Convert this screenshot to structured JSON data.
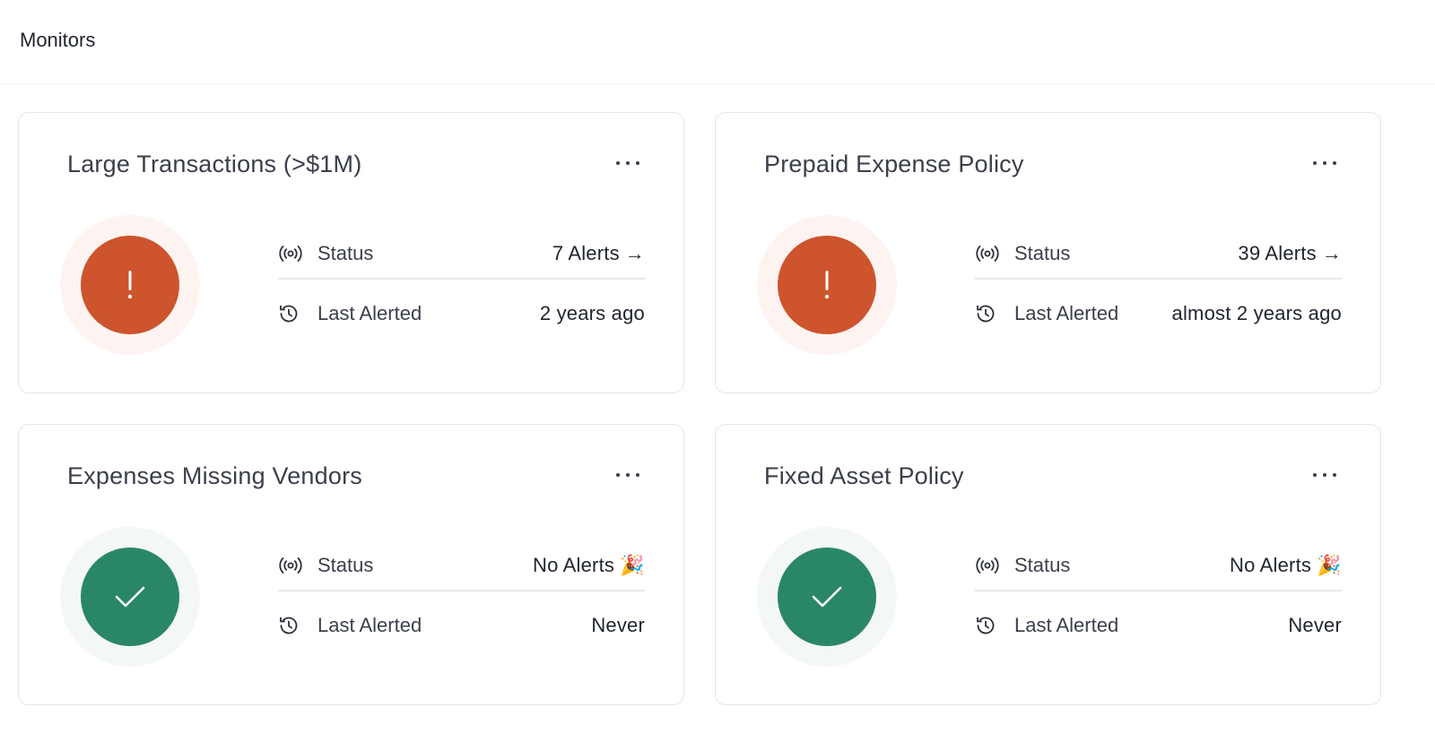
{
  "header": {
    "title": "Monitors"
  },
  "labels": {
    "status": "Status",
    "last_alerted": "Last Alerted"
  },
  "colors": {
    "alert": "#cd542c",
    "ok": "#2a8766"
  },
  "monitors": [
    {
      "title": "Large Transactions (>$1M)",
      "state": "alert",
      "status_value": "7 Alerts",
      "status_arrow": "→",
      "last_alerted": "2 years ago",
      "status_icon": "exclamation-icon"
    },
    {
      "title": "Prepaid Expense Policy",
      "state": "alert",
      "status_value": "39 Alerts",
      "status_arrow": "→",
      "last_alerted": "almost 2 years ago",
      "status_icon": "exclamation-icon"
    },
    {
      "title": "Expenses Missing Vendors",
      "state": "ok",
      "status_value": "No Alerts 🎉",
      "status_arrow": "",
      "last_alerted": "Never",
      "status_icon": "check-icon"
    },
    {
      "title": "Fixed Asset Policy",
      "state": "ok",
      "status_value": "No Alerts 🎉",
      "status_arrow": "",
      "last_alerted": "Never",
      "status_icon": "check-icon"
    }
  ]
}
